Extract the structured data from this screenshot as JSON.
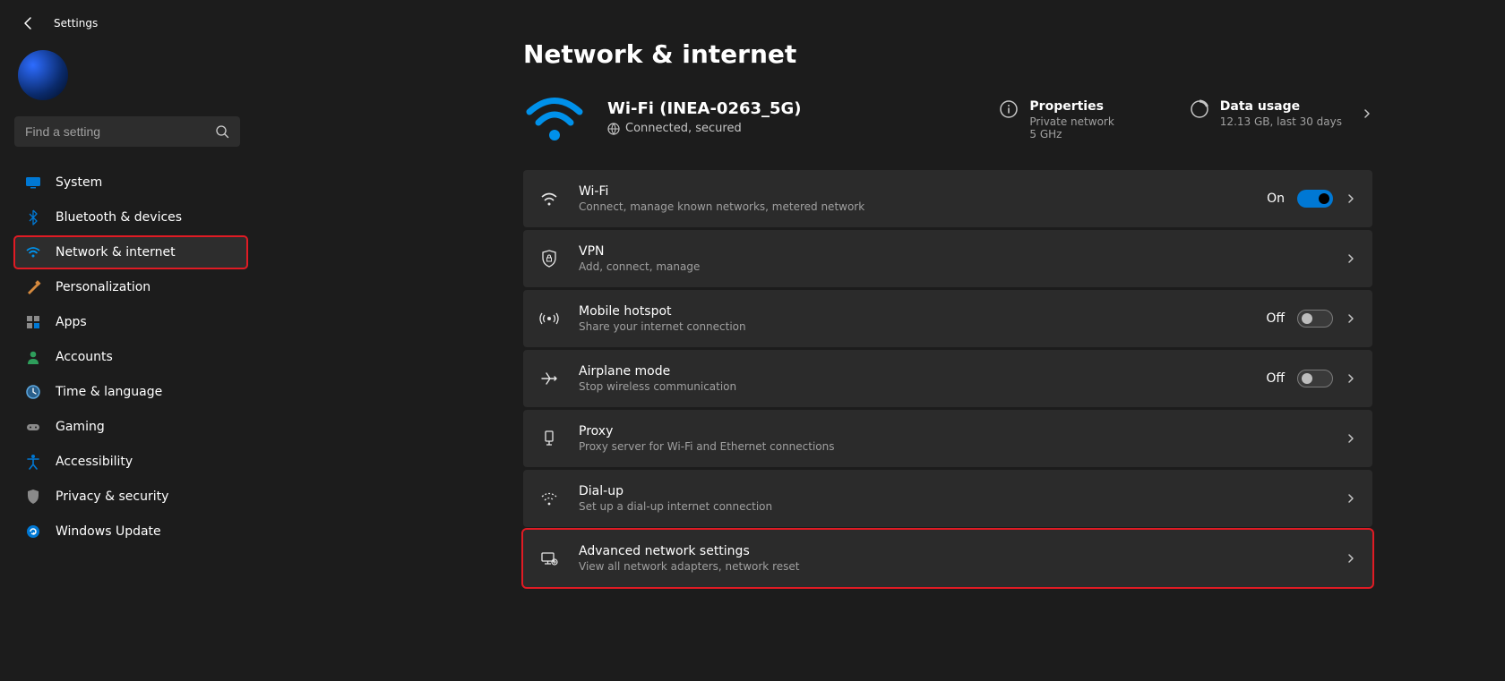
{
  "header": {
    "title": "Settings"
  },
  "search": {
    "placeholder": "Find a setting"
  },
  "sidebar": {
    "items": [
      {
        "label": "System"
      },
      {
        "label": "Bluetooth & devices"
      },
      {
        "label": "Network & internet"
      },
      {
        "label": "Personalization"
      },
      {
        "label": "Apps"
      },
      {
        "label": "Accounts"
      },
      {
        "label": "Time & language"
      },
      {
        "label": "Gaming"
      },
      {
        "label": "Accessibility"
      },
      {
        "label": "Privacy & security"
      },
      {
        "label": "Windows Update"
      }
    ]
  },
  "page": {
    "title": "Network & internet"
  },
  "status": {
    "ssid": "Wi-Fi (INEA-0263_5G)",
    "connection": "Connected, secured",
    "properties": {
      "title": "Properties",
      "line1": "Private network",
      "line2": "5 GHz"
    },
    "usage": {
      "title": "Data usage",
      "line1": "12.13 GB, last 30 days"
    }
  },
  "items": [
    {
      "title": "Wi-Fi",
      "sub": "Connect, manage known networks, metered network",
      "toggle": "On",
      "toggle_on": true
    },
    {
      "title": "VPN",
      "sub": "Add, connect, manage"
    },
    {
      "title": "Mobile hotspot",
      "sub": "Share your internet connection",
      "toggle": "Off",
      "toggle_on": false
    },
    {
      "title": "Airplane mode",
      "sub": "Stop wireless communication",
      "toggle": "Off",
      "toggle_on": false
    },
    {
      "title": "Proxy",
      "sub": "Proxy server for Wi-Fi and Ethernet connections"
    },
    {
      "title": "Dial-up",
      "sub": "Set up a dial-up internet connection"
    },
    {
      "title": "Advanced network settings",
      "sub": "View all network adapters, network reset"
    }
  ]
}
